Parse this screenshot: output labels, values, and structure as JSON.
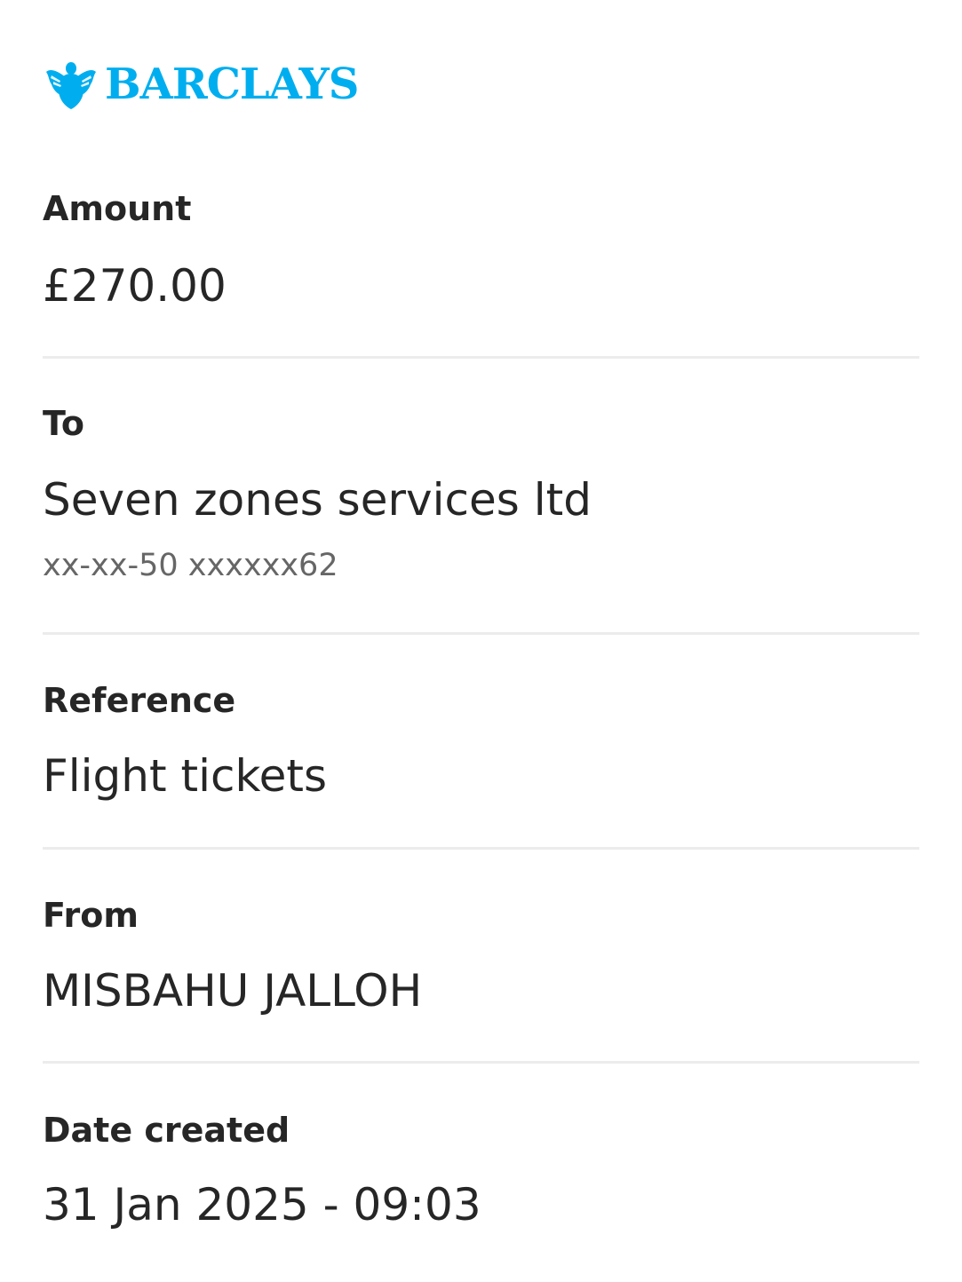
{
  "brand": {
    "name": "BARCLAYS",
    "color": "#00AEEF",
    "icon": "eagle-icon"
  },
  "text_color": "#262626",
  "muted_color": "#666666",
  "divider_color": "#ececec",
  "details": {
    "amount": {
      "label": "Amount",
      "value": "£270.00"
    },
    "to": {
      "label": "To",
      "value": "Seven zones services ltd",
      "account": "xx-xx-50 xxxxxx62"
    },
    "reference": {
      "label": "Reference",
      "value": "Flight tickets"
    },
    "from": {
      "label": "From",
      "value": "MISBAHU JALLOH"
    },
    "date_created": {
      "label": "Date created",
      "value": "31 Jan 2025 - 09:03"
    }
  }
}
